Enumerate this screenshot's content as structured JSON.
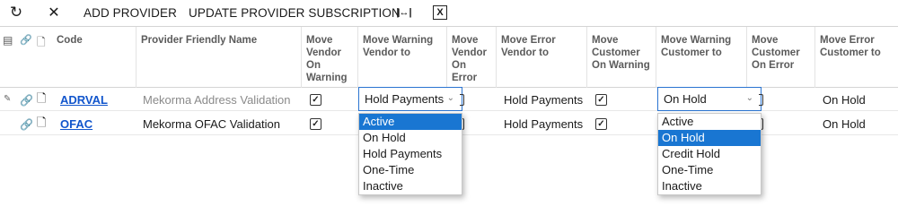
{
  "toolbar": {
    "refresh_icon": "↻",
    "close_icon": "✕",
    "add_provider": "ADD PROVIDER",
    "update_subscription": "UPDATE PROVIDER SUBSCRIPTION",
    "fit_columns_icon": "|↔|",
    "excel_icon": "X"
  },
  "grid": {
    "header_icons": {
      "row_selector_icon": "▤",
      "attachment_icon": "🔗",
      "file_icon": "🗋"
    },
    "columns": {
      "code": "Code",
      "friendly_name": "Provider Friendly Name",
      "move_vendor_on_warning": "Move Vendor On Warning",
      "move_warning_vendor_to": "Move Warning Vendor to",
      "move_vendor_on_error": "Move Vendor On Error",
      "move_error_vendor_to": "Move Error Vendor to",
      "move_customer_on_warning": "Move Customer On Warning",
      "move_warning_customer_to": "Move Warning Customer to",
      "move_customer_on_error": "Move Customer On Error",
      "move_error_customer_to": "Move Error Customer to"
    },
    "rows": [
      {
        "edit_marker": "✎",
        "code": "ADRVAL",
        "friendly_name": "Mekorma Address Validation",
        "move_vendor_on_warning": "✓",
        "move_warning_vendor_to": "Hold Payments",
        "move_error_vendor_to": "Hold Payments",
        "move_customer_on_warning": "✓",
        "move_warning_customer_to": "On Hold",
        "move_error_customer_to": "On Hold"
      },
      {
        "code": "OFAC",
        "friendly_name": "Mekorma OFAC Validation",
        "move_vendor_on_warning": "✓",
        "move_error_vendor_to": "Hold Payments",
        "move_customer_on_warning": "✓",
        "move_error_customer_to": "On Hold"
      }
    ],
    "vendor_dropdown": {
      "selected": "Active",
      "options": [
        "Active",
        "On Hold",
        "Hold Payments",
        "One-Time",
        "Inactive"
      ]
    },
    "customer_dropdown": {
      "selected": "On Hold",
      "options": [
        "Active",
        "On Hold",
        "Credit Hold",
        "One-Time",
        "Inactive"
      ]
    },
    "chevron_icon": "⌄"
  },
  "colors": {
    "link": "#1155cc",
    "focus_border": "#2a74d1",
    "selected_option_bg": "#1976d2"
  }
}
